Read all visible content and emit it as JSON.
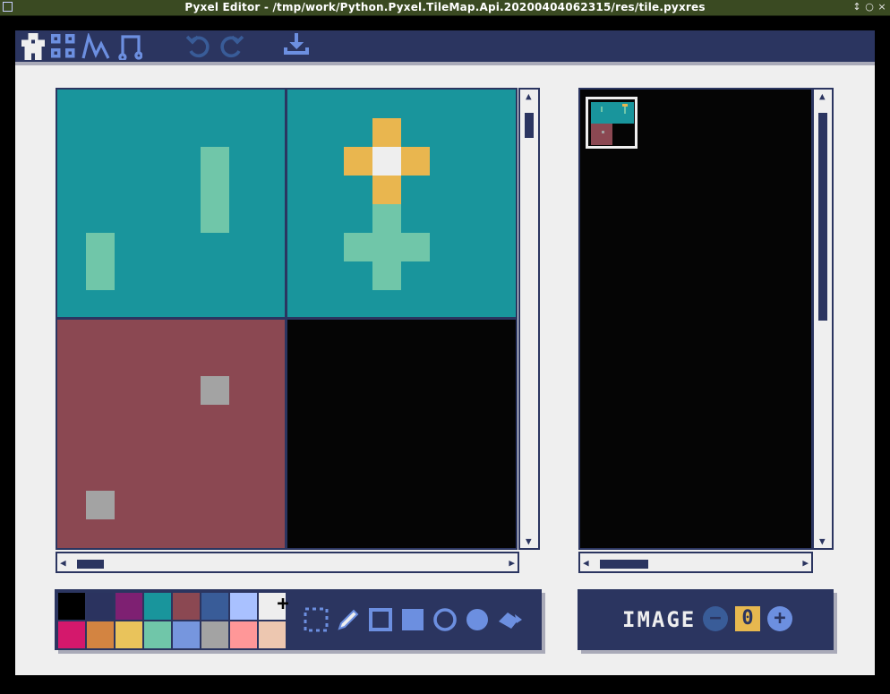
{
  "window": {
    "title": "Pyxel Editor - /tmp/work/Python.Pyxel.TileMap.Api.20200404062315/res/tile.pyxres",
    "controls": [
      "↕",
      "○",
      "×"
    ]
  },
  "toolbar": {
    "editors": [
      {
        "name": "image-editor-icon",
        "active": true
      },
      {
        "name": "tilemap-editor-icon",
        "active": false
      },
      {
        "name": "sound-editor-icon",
        "active": false
      },
      {
        "name": "music-editor-icon",
        "active": false
      }
    ],
    "undo_icon": "undo-icon",
    "redo_icon": "redo-icon",
    "save_icon": "save-icon"
  },
  "palette": {
    "colors": [
      "#000000",
      "#2b335f",
      "#7e2072",
      "#19959c",
      "#8b4852",
      "#395c98",
      "#a9c1ff",
      "#eeeeee",
      "#d4186c",
      "#d38441",
      "#e9c35b",
      "#70c6a9",
      "#7696de",
      "#a3a3a3",
      "#ff9798",
      "#edc7b0"
    ],
    "selected_index": 7,
    "selected_marker": "+"
  },
  "tools": [
    "select-tool-icon",
    "pencil-tool-icon",
    "rect-outline-tool-icon",
    "rect-fill-tool-icon",
    "circle-outline-tool-icon",
    "circle-fill-tool-icon",
    "bucket-tool-icon"
  ],
  "image_selector": {
    "label": "IMAGE",
    "value": "0",
    "minus": "−",
    "plus": "+"
  }
}
